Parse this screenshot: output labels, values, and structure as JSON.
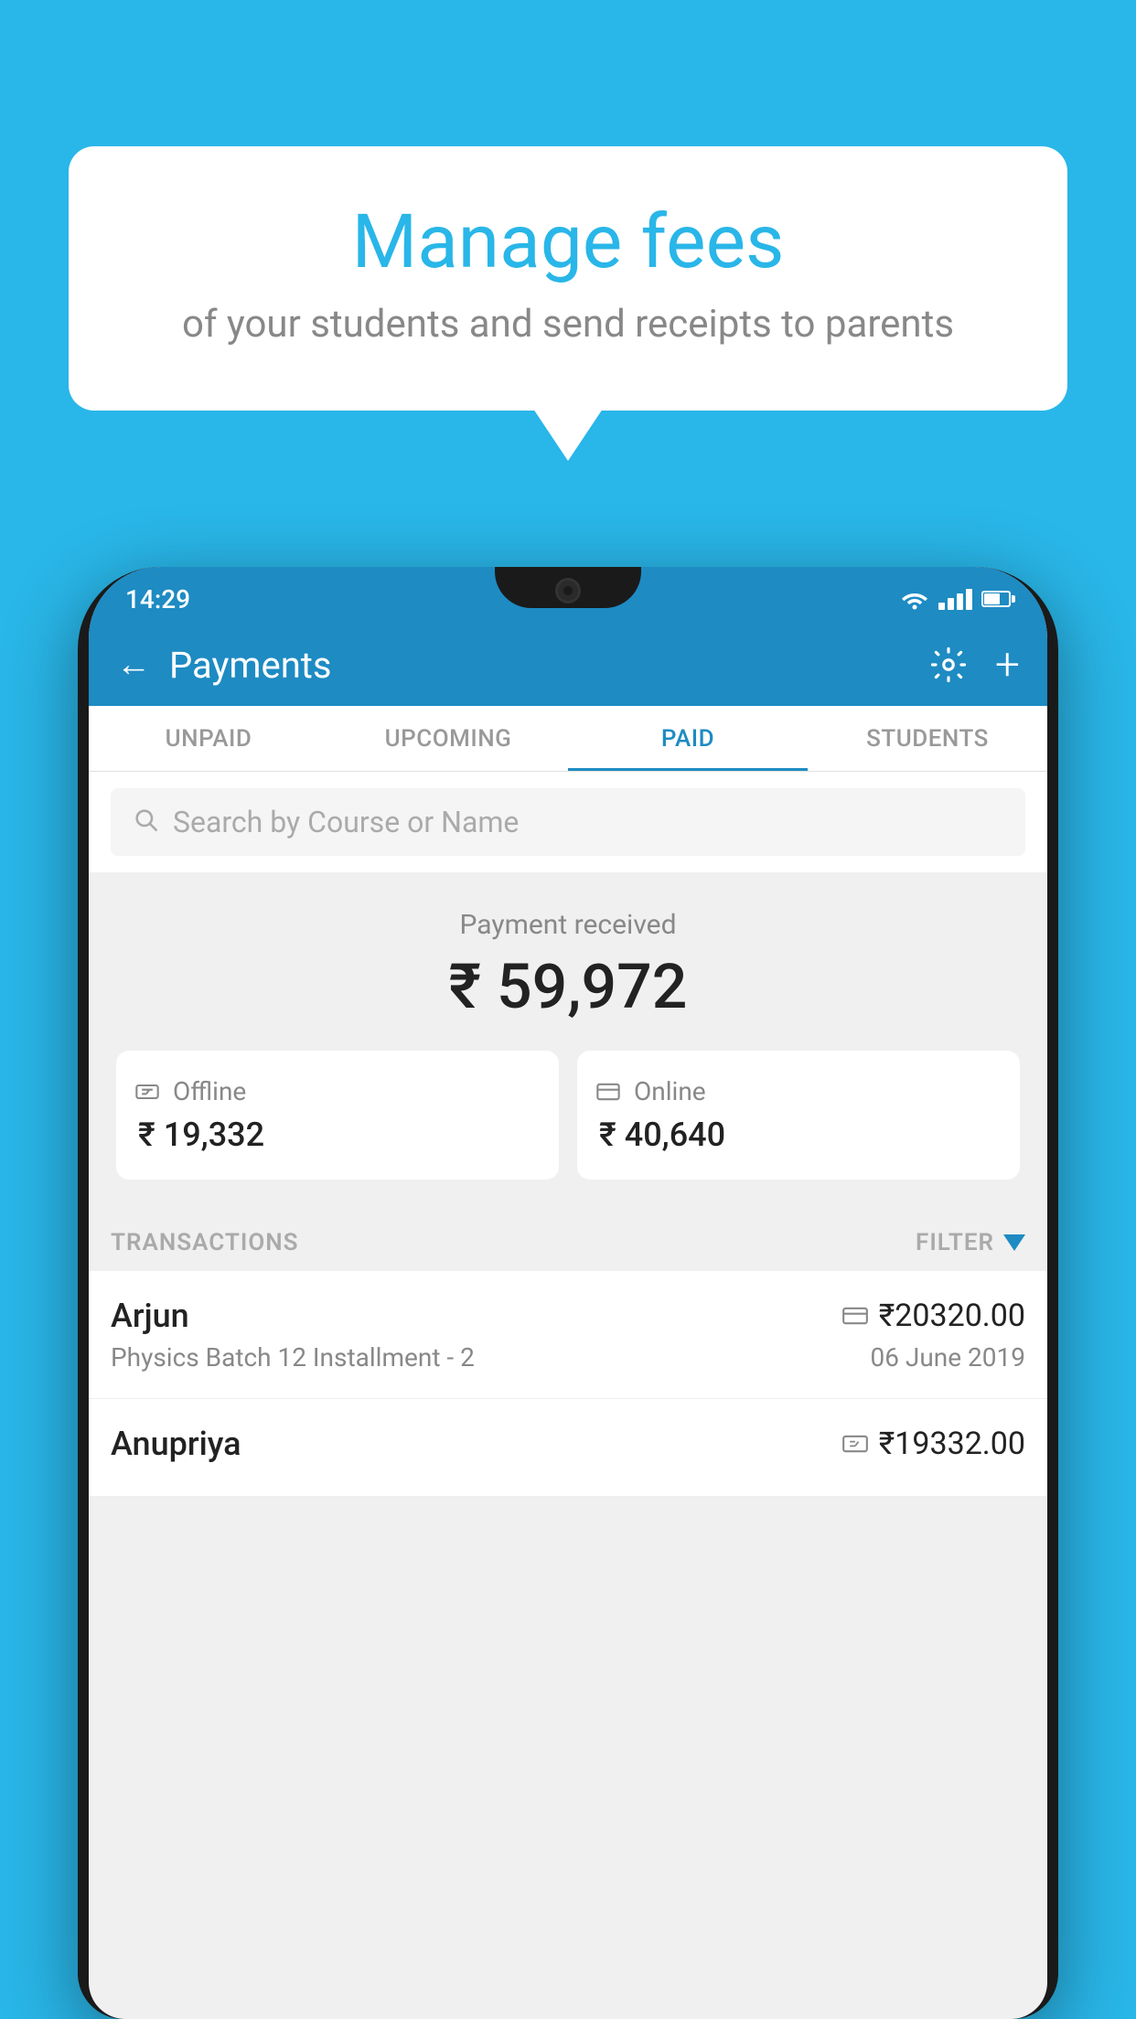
{
  "background_color": "#29b6e8",
  "bubble": {
    "title": "Manage fees",
    "subtitle": "of your students and send receipts to parents"
  },
  "status_bar": {
    "time": "14:29"
  },
  "app_bar": {
    "title": "Payments",
    "back_label": "←"
  },
  "tabs": [
    {
      "id": "unpaid",
      "label": "UNPAID",
      "active": false
    },
    {
      "id": "upcoming",
      "label": "UPCOMING",
      "active": false
    },
    {
      "id": "paid",
      "label": "PAID",
      "active": true
    },
    {
      "id": "students",
      "label": "STUDENTS",
      "active": false
    }
  ],
  "search": {
    "placeholder": "Search by Course or Name"
  },
  "payment_summary": {
    "label": "Payment received",
    "amount": "₹ 59,972",
    "offline": {
      "label": "Offline",
      "amount": "₹ 19,332"
    },
    "online": {
      "label": "Online",
      "amount": "₹ 40,640"
    }
  },
  "transactions": {
    "label": "TRANSACTIONS",
    "filter_label": "FILTER",
    "rows": [
      {
        "name": "Arjun",
        "amount": "₹20320.00",
        "payment_type": "card",
        "course": "Physics Batch 12 Installment - 2",
        "date": "06 June 2019"
      },
      {
        "name": "Anupriya",
        "amount": "₹19332.00",
        "payment_type": "cash",
        "course": "",
        "date": ""
      }
    ]
  },
  "icons": {
    "search": "🔍",
    "gear": "⚙",
    "plus": "+",
    "back_arrow": "←",
    "card": "💳",
    "rupee_note": "💵"
  }
}
